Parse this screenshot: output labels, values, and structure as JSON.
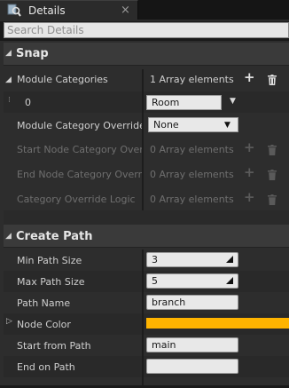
{
  "tab": {
    "title": "Details",
    "close": "×"
  },
  "search": {
    "placeholder": "Search Details"
  },
  "snap": {
    "header": "Snap",
    "module_categories": {
      "label": "Module Categories",
      "value": "1 Array elements",
      "add": "+",
      "element_index": "0",
      "element_value": "Room"
    },
    "override_map": {
      "label": "Module Category Override M",
      "value": "None"
    },
    "start_override": {
      "label": "Start Node Category Overrid",
      "value": "0 Array elements"
    },
    "end_override": {
      "label": "End Node Category Override",
      "value": "0 Array elements"
    },
    "override_logic": {
      "label": "Category Override Logic",
      "value": "0 Array elements"
    }
  },
  "create_path": {
    "header": "Create Path",
    "min_path_size": {
      "label": "Min Path Size",
      "value": "3"
    },
    "max_path_size": {
      "label": "Max Path Size",
      "value": "5"
    },
    "path_name": {
      "label": "Path Name",
      "value": "branch"
    },
    "node_color": {
      "label": "Node Color",
      "color": "#ffb400"
    },
    "start_from_path": {
      "label": "Start from Path",
      "value": "main"
    },
    "end_on_path": {
      "label": "End on Path",
      "value": ""
    }
  },
  "colors": {
    "accent": "#ffb400",
    "panel": "#2d2d2d",
    "header": "#3a3a3a"
  },
  "icons": [
    "details-magnifier-icon",
    "close-icon",
    "collapse-arrow-icon",
    "add-icon",
    "trash-icon",
    "drag-handle-icon",
    "dropdown-arrow-icon",
    "expand-arrow-icon"
  ]
}
